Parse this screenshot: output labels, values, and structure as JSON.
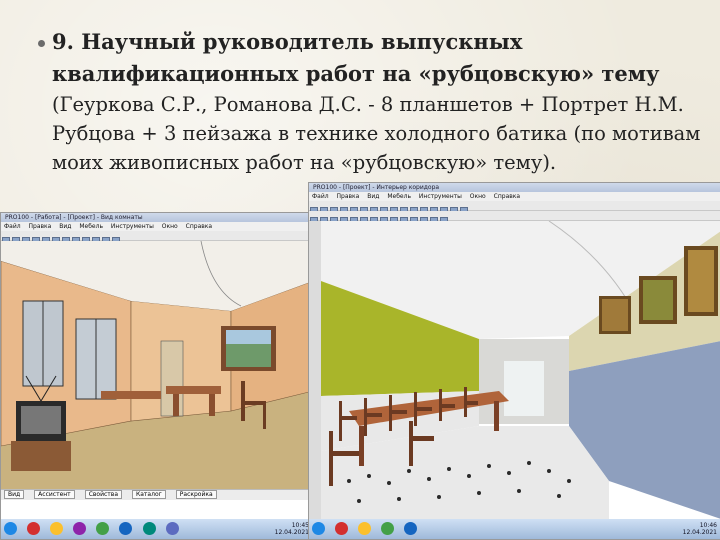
{
  "slide": {
    "heading": "9. Научный руководитель выпускных квалификационных работ на «рубцовскую» тему",
    "body": "(Геуркова С.Р., Романова Д.С. - 8 планшетов + Портрет Н.М. Рубцова + 3 пейзажа в технике холодного батика (по мотивам моих живописных работ на «рубцовскую» тему)."
  },
  "left_window": {
    "title": "PRO100 - [Работа] - [Проект] - Вид комнаты",
    "menu": [
      "Файл",
      "Правка",
      "Вид",
      "Мебель",
      "Инструменты",
      "Окно",
      "Справка"
    ],
    "status": [
      "Вид",
      "Ассистент",
      "Свойства",
      "Каталог",
      "Раскройка"
    ],
    "tray_time": "10:45",
    "tray_date": "12.04.2021"
  },
  "right_window": {
    "title": "PRO100 - [Проект] - Интерьер коридора",
    "menu": [
      "Файл",
      "Правка",
      "Вид",
      "Мебель",
      "Инструменты",
      "Окно",
      "Справка"
    ],
    "tray_time": "10:46",
    "tray_date": "12.04.2021"
  },
  "colors": {
    "paper": "#efebdf",
    "text": "#222222",
    "wall_peach": "#e9b98b",
    "wall_green": "#a9b52a",
    "wall_gray": "#8e9fbe"
  }
}
